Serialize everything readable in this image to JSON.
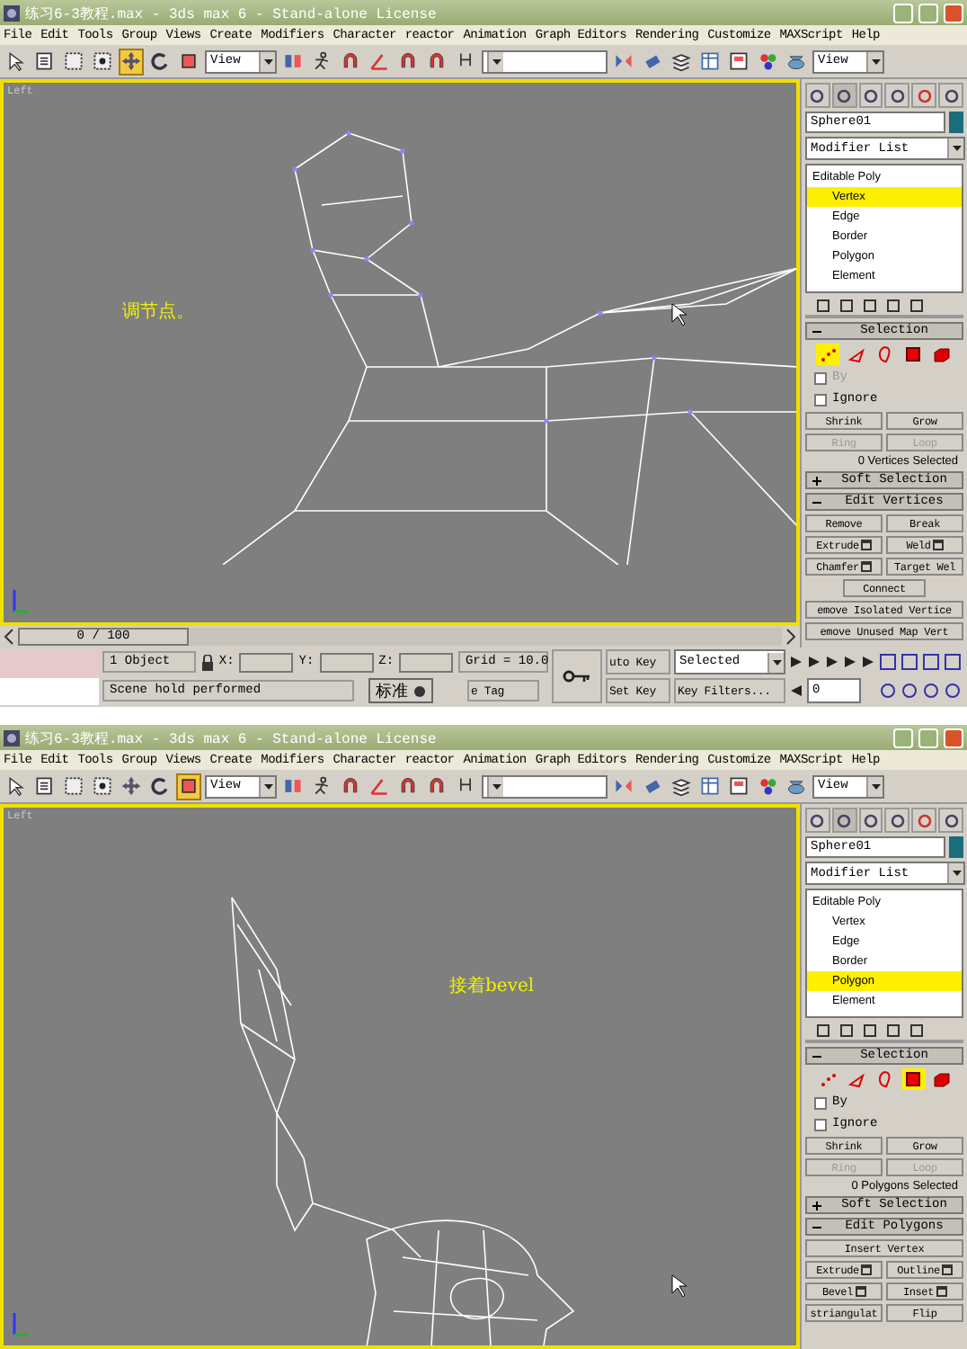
{
  "screens": [
    {
      "window": {
        "title": "练习6-3教程.max - 3ds max 6 - Stand-alone License"
      },
      "menu": [
        "File",
        "Edit",
        "Tools",
        "Group",
        "Views",
        "Create",
        "Modifiers",
        "Character",
        "reactor",
        "Animation",
        "Graph Editors",
        "Rendering",
        "Customize",
        "MAXScript",
        "Help"
      ],
      "toolbar": [
        {
          "kind": "cursor",
          "selected": false
        },
        {
          "kind": "list",
          "selected": false
        },
        {
          "kind": "region",
          "selected": false
        },
        {
          "kind": "crossing",
          "selected": false
        },
        {
          "kind": "move",
          "selected": true
        },
        {
          "kind": "rotate",
          "selected": false
        },
        {
          "kind": "scale",
          "selected": false
        },
        {
          "kind": "dropdown",
          "value": "View"
        },
        {
          "kind": "pivot",
          "selected": false
        },
        {
          "kind": "figure",
          "selected": false
        },
        {
          "kind": "magnet",
          "selected": false
        },
        {
          "kind": "angle",
          "selected": false
        },
        {
          "kind": "magnet",
          "selected": false
        },
        {
          "kind": "magnet",
          "selected": false
        },
        {
          "kind": "named",
          "selected": false
        },
        {
          "kind": "dropdown"
        },
        {
          "kind": "mirror",
          "selected": false
        },
        {
          "kind": "align",
          "selected": false
        },
        {
          "kind": "layers",
          "selected": false
        },
        {
          "kind": "grid",
          "selected": false
        },
        {
          "kind": "schematic",
          "selected": false
        },
        {
          "kind": "spheres",
          "selected": false
        },
        {
          "kind": "teapot",
          "selected": false
        },
        {
          "kind": "dropdown",
          "value": "View"
        }
      ],
      "viewport": {
        "label": "Left",
        "annotation": "调节点。",
        "kind": "closeup"
      },
      "panel": {
        "tabs": [
          {
            "selected": false
          },
          {
            "selected": true
          },
          {
            "selected": false
          },
          {
            "selected": false
          },
          {
            "selected": false
          },
          {
            "selected": false
          }
        ],
        "object_name": "Sphere01",
        "modifier_list": "Modifier List",
        "stack": [
          {
            "label": "Editable Poly",
            "selected": false,
            "children": [
              {
                "label": "Vertex",
                "selected": true
              },
              {
                "label": "Edge",
                "selected": false
              },
              {
                "label": "Border",
                "selected": false
              },
              {
                "label": "Polygon",
                "selected": false
              },
              {
                "label": "Element",
                "selected": false
              }
            ]
          }
        ],
        "selection": {
          "title": "Selection",
          "subobjects": [
            {
              "kind": "vertex",
              "selected": true
            },
            {
              "kind": "edge",
              "selected": false
            },
            {
              "kind": "border",
              "selected": false
            },
            {
              "kind": "polygon",
              "selected": false
            },
            {
              "kind": "element",
              "selected": false
            }
          ],
          "checks": [
            {
              "label": "By",
              "checked": false,
              "disabled": true
            },
            {
              "label": "Ignore",
              "checked": false,
              "disabled": false
            }
          ],
          "buttons": [
            {
              "label": "Shrink",
              "disabled": false
            },
            {
              "label": "Grow",
              "disabled": false
            },
            {
              "label": "Ring",
              "disabled": true
            },
            {
              "label": "Loop",
              "disabled": true
            }
          ],
          "status": "0 Vertices Selected"
        },
        "rollouts": [
          {
            "title": "Soft Selection",
            "expanded": false
          },
          {
            "title": "Edit Vertices",
            "expanded": true,
            "buttons": [
              {
                "label": "Remove",
                "kind": "half",
                "settings": false
              },
              {
                "label": "Break",
                "kind": "half",
                "settings": false
              },
              {
                "label": "Extrude",
                "kind": "half",
                "settings": true
              },
              {
                "label": "Weld",
                "kind": "half",
                "settings": true
              },
              {
                "label": "Chamfer",
                "kind": "half",
                "settings": true
              },
              {
                "label": "Target Wel",
                "kind": "half",
                "settings": false
              },
              {
                "label": "Connect",
                "kind": "center",
                "settings": false
              },
              {
                "label": "emove Isolated Vertice",
                "kind": "full",
                "settings": false
              },
              {
                "label": "emove Unused Map Vert",
                "kind": "full",
                "settings": false
              }
            ]
          }
        ]
      },
      "status": {
        "track": "0 / 100",
        "level": 0,
        "objects": "1 Object",
        "coords": [
          "X:",
          "Y:",
          "Z:"
        ],
        "grid": "Grid = 10.0",
        "auto_key": "uto Key",
        "key_mode": "Selected",
        "set_key": "Set Key",
        "key_filters": "Key Filters...",
        "frame": "0",
        "prompt": "Scene hold performed",
        "time_tag": "e Tag",
        "ime": "标准"
      }
    },
    {
      "window": {
        "title": "练习6-3教程.max - 3ds max 6 - Stand-alone License"
      },
      "menu": [
        "File",
        "Edit",
        "Tools",
        "Group",
        "Views",
        "Create",
        "Modifiers",
        "Character",
        "reactor",
        "Animation",
        "Graph Editors",
        "Rendering",
        "Customize",
        "MAXScript",
        "Help"
      ],
      "toolbar": [
        {
          "kind": "cursor",
          "selected": false
        },
        {
          "kind": "list",
          "selected": false
        },
        {
          "kind": "region",
          "selected": false
        },
        {
          "kind": "crossing",
          "selected": false
        },
        {
          "kind": "move",
          "selected": false
        },
        {
          "kind": "rotate",
          "selected": false
        },
        {
          "kind": "scale",
          "selected": true
        },
        {
          "kind": "dropdown",
          "value": "View"
        },
        {
          "kind": "pivot",
          "selected": false
        },
        {
          "kind": "figure",
          "selected": false
        },
        {
          "kind": "magnet",
          "selected": false
        },
        {
          "kind": "angle",
          "selected": false
        },
        {
          "kind": "magnet",
          "selected": false
        },
        {
          "kind": "magnet",
          "selected": false
        },
        {
          "kind": "named",
          "selected": false
        },
        {
          "kind": "dropdown"
        },
        {
          "kind": "mirror",
          "selected": false
        },
        {
          "kind": "align",
          "selected": false
        },
        {
          "kind": "layers",
          "selected": false
        },
        {
          "kind": "grid",
          "selected": false
        },
        {
          "kind": "schematic",
          "selected": false
        },
        {
          "kind": "spheres",
          "selected": false
        },
        {
          "kind": "teapot",
          "selected": false
        },
        {
          "kind": "dropdown",
          "value": "View"
        }
      ],
      "viewport": {
        "label": "Left",
        "annotation": "接着bevel",
        "kind": "full"
      },
      "panel": {
        "tabs": [
          {
            "selected": false
          },
          {
            "selected": true
          },
          {
            "selected": false
          },
          {
            "selected": false
          },
          {
            "selected": false
          },
          {
            "selected": false
          }
        ],
        "object_name": "Sphere01",
        "modifier_list": "Modifier List",
        "stack": [
          {
            "label": "Editable Poly",
            "selected": false,
            "children": [
              {
                "label": "Vertex",
                "selected": false
              },
              {
                "label": "Edge",
                "selected": false
              },
              {
                "label": "Border",
                "selected": false
              },
              {
                "label": "Polygon",
                "selected": true
              },
              {
                "label": "Element",
                "selected": false
              }
            ]
          }
        ],
        "selection": {
          "title": "Selection",
          "subobjects": [
            {
              "kind": "vertex",
              "selected": false
            },
            {
              "kind": "edge",
              "selected": false
            },
            {
              "kind": "border",
              "selected": false
            },
            {
              "kind": "polygon",
              "selected": true
            },
            {
              "kind": "element",
              "selected": false
            }
          ],
          "checks": [
            {
              "label": "By",
              "checked": false,
              "disabled": false
            },
            {
              "label": "Ignore",
              "checked": false,
              "disabled": false
            }
          ],
          "buttons": [
            {
              "label": "Shrink",
              "disabled": false
            },
            {
              "label": "Grow",
              "disabled": false
            },
            {
              "label": "Ring",
              "disabled": true
            },
            {
              "label": "Loop",
              "disabled": true
            }
          ],
          "status": "0 Polygons Selected"
        },
        "rollouts": [
          {
            "title": "Soft Selection",
            "expanded": false
          },
          {
            "title": "Edit Polygons",
            "expanded": true,
            "buttons": [
              {
                "label": "Insert Vertex",
                "kind": "full",
                "settings": false
              },
              {
                "label": "Extrude",
                "kind": "half",
                "settings": true
              },
              {
                "label": "Outline",
                "kind": "half",
                "settings": true
              },
              {
                "label": "Bevel",
                "kind": "half",
                "settings": true
              },
              {
                "label": "Inset",
                "kind": "half",
                "settings": true
              },
              {
                "label": "striangulat",
                "kind": "half",
                "settings": false
              },
              {
                "label": "Flip",
                "kind": "half",
                "settings": false
              }
            ]
          }
        ]
      }
    }
  ]
}
